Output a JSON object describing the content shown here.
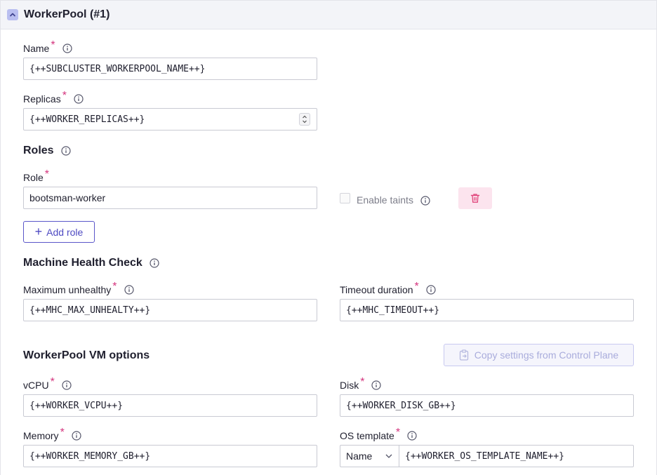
{
  "header": {
    "title": "WorkerPool (#1)",
    "collapse_icon": "chevron-up-icon"
  },
  "fields": {
    "name": {
      "label": "Name",
      "value": "{++SUBCLUSTER_WORKERPOOL_NAME++}"
    },
    "replicas": {
      "label": "Replicas",
      "value": "{++WORKER_REPLICAS++}"
    }
  },
  "roles": {
    "title": "Roles",
    "role_label": "Role",
    "role_value": "bootsman-worker",
    "enable_taints_label": "Enable taints",
    "add_role_label": "Add role"
  },
  "mhc": {
    "title": "Machine Health Check",
    "max_unhealthy_label": "Maximum unhealthy",
    "max_unhealthy_value": "{++MHC_MAX_UNHEALTY++}",
    "timeout_label": "Timeout duration",
    "timeout_value": "{++MHC_TIMEOUT++}"
  },
  "vm": {
    "title": "WorkerPool VM options",
    "copy_button_label": "Copy settings from Control Plane",
    "vcpu_label": "vCPU",
    "vcpu_value": "{++WORKER_VCPU++}",
    "disk_label": "Disk",
    "disk_value": "{++WORKER_DISK_GB++}",
    "memory_label": "Memory",
    "memory_value": "{++WORKER_MEMORY_GB++}",
    "os_label": "OS template",
    "os_select_value": "Name",
    "os_value": "{++WORKER_OS_TEMPLATE_NAME++}"
  },
  "colors": {
    "accent": "#4e4ac2",
    "required": "#d4357e",
    "danger": "#e0457b",
    "header_bg": "#f3f4f8"
  }
}
